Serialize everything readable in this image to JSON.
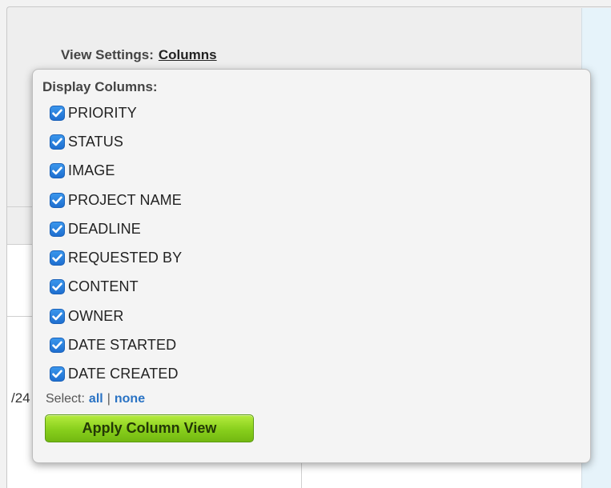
{
  "view_settings": {
    "label": "View Settings:",
    "link": "Columns"
  },
  "background": {
    "cut_text": "/24"
  },
  "popup": {
    "title": "Display Columns:",
    "columns": [
      {
        "label": "PRIORITY",
        "checked": true
      },
      {
        "label": "STATUS",
        "checked": true
      },
      {
        "label": "IMAGE",
        "checked": true
      },
      {
        "label": "PROJECT NAME",
        "checked": true
      },
      {
        "label": "DEADLINE",
        "checked": true
      },
      {
        "label": "REQUESTED BY",
        "checked": true
      },
      {
        "label": "CONTENT",
        "checked": true
      },
      {
        "label": "OWNER",
        "checked": true
      },
      {
        "label": "DATE STARTED",
        "checked": true
      },
      {
        "label": "DATE CREATED",
        "checked": true
      }
    ],
    "select": {
      "prefix": "Select:",
      "all": "all",
      "separator": "|",
      "none": "none"
    },
    "apply_button": "Apply Column View"
  },
  "icons": {
    "checkbox": "checkmark-icon"
  },
  "colors": {
    "checkbox": "#2a7fdc",
    "link": "#2a73c4",
    "apply_button": "#8fd11f"
  }
}
